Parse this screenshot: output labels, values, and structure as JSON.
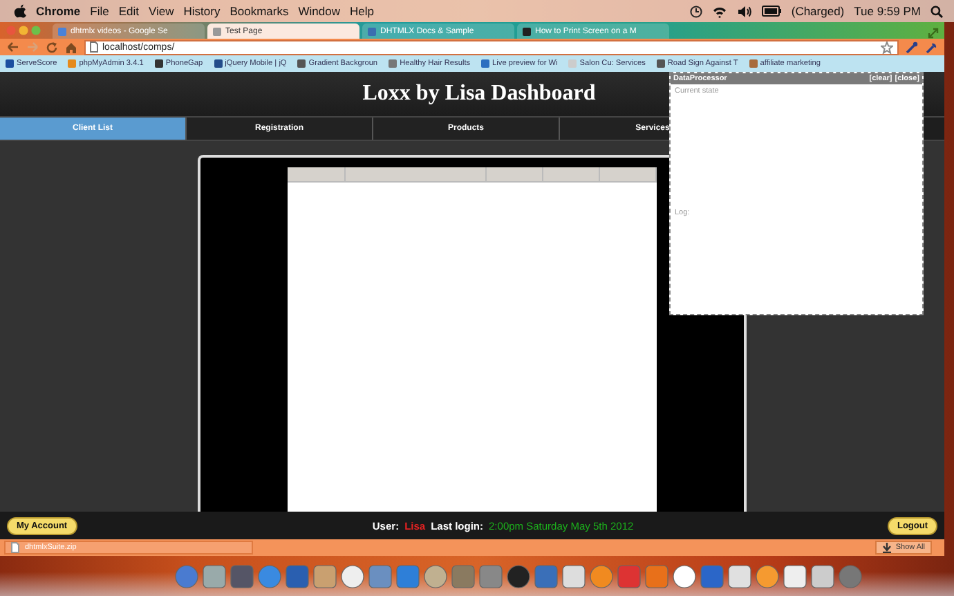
{
  "menu_bar": {
    "items": [
      {
        "label": "Chrome",
        "bold": true
      },
      {
        "label": "File",
        "bold": false
      },
      {
        "label": "Edit",
        "bold": false
      },
      {
        "label": "View",
        "bold": false
      },
      {
        "label": "History",
        "bold": false
      },
      {
        "label": "Bookmarks",
        "bold": false
      },
      {
        "label": "Window",
        "bold": false
      },
      {
        "label": "Help",
        "bold": false
      }
    ],
    "battery": "(Charged)",
    "clock": "Tue 9:59 PM"
  },
  "browser": {
    "tabs": [
      {
        "label": "dhtmlx videos - Google Se",
        "selected": false
      },
      {
        "label": "Test Page",
        "selected": true
      },
      {
        "label": "DHTMLX Docs & Sample",
        "selected": false
      },
      {
        "label": "How to Print Screen on a M",
        "selected": false
      }
    ],
    "address": "localhost/comps/",
    "bookmarks": [
      "ServeScore",
      "phpMyAdmin 3.4.1",
      "PhoneGap",
      "jQuery Mobile | jQ",
      "Gradient Backgroun",
      "Healthy Hair Results",
      "Live preview for Wi",
      "Salon Cu: Services",
      "Road Sign Against T",
      "affiliate marketing"
    ]
  },
  "page": {
    "title": "Loxx by Lisa Dashboard",
    "nav": [
      {
        "label": "Client List",
        "selected": true
      },
      {
        "label": "Registration",
        "selected": false
      },
      {
        "label": "Products",
        "selected": false
      },
      {
        "label": "Services",
        "selected": false
      }
    ],
    "footer": {
      "account_button": "My Account",
      "user_label": "User:",
      "user": "Lisa",
      "login_label": "Last login:",
      "login_time": "2:00pm Saturday May 5th 2012",
      "logout_button": "Logout"
    }
  },
  "data_processor": {
    "title": "DataProcessor",
    "clear": "[clear]",
    "close": "[close]",
    "state_label": "Current state",
    "log_label": "Log:"
  },
  "downloads": {
    "file": "dhtmlxSuite.zip",
    "show_all": "Show All"
  }
}
